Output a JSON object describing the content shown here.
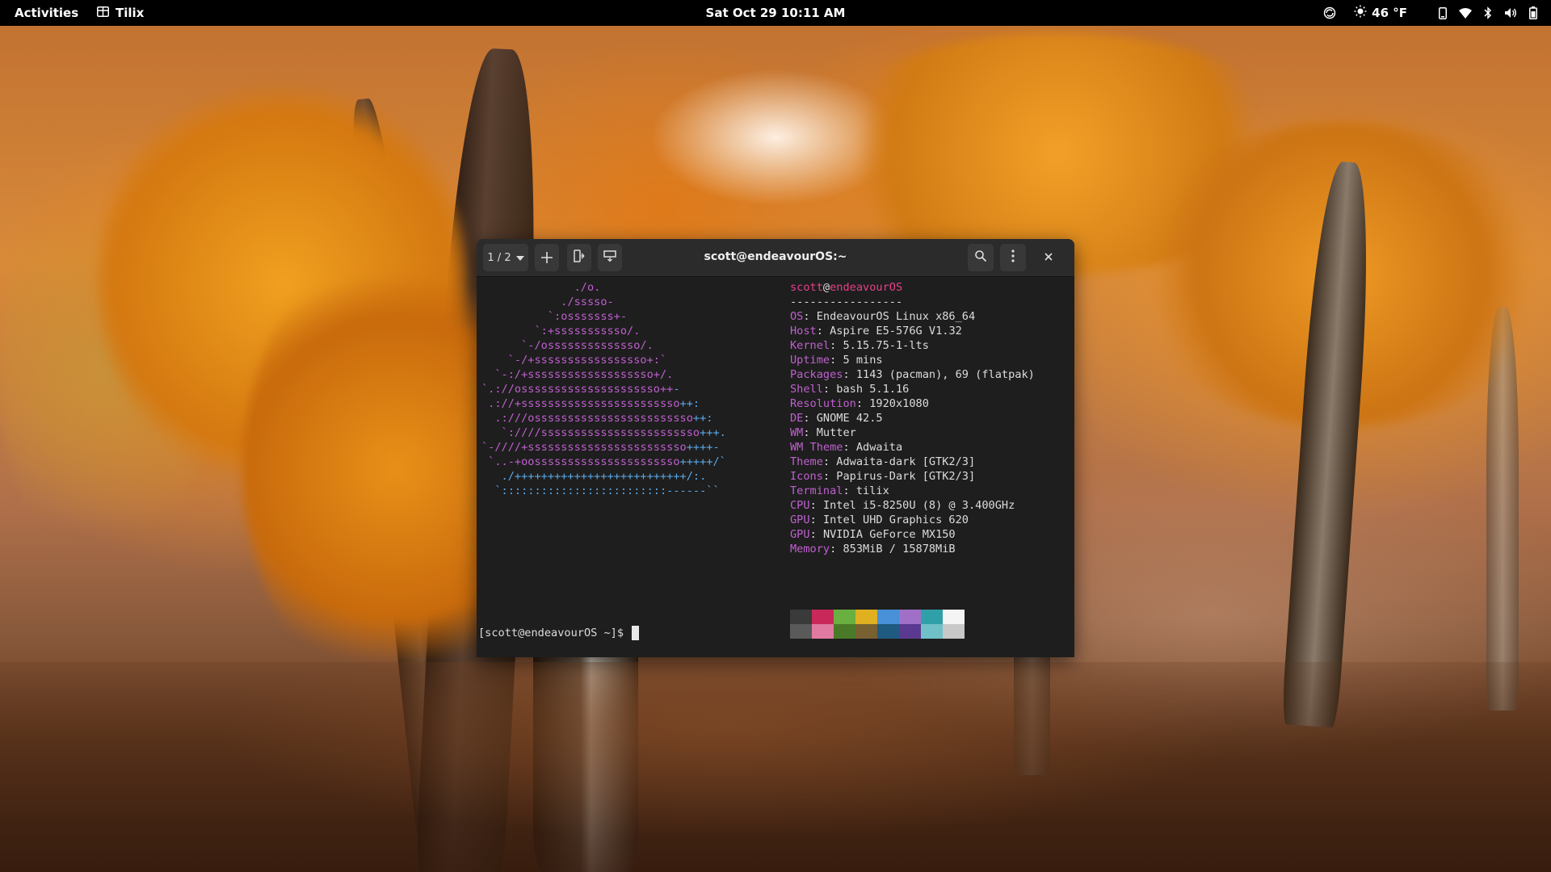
{
  "topbar": {
    "activities": "Activities",
    "app_name": "Tilix",
    "clock": "Sat Oct 29  10:11 AM",
    "weather": "46 °F",
    "tray_icons": [
      "screen-share-icon",
      "weather-sun-icon",
      "phone-icon",
      "wifi-icon",
      "bluetooth-icon",
      "volume-icon",
      "battery-icon"
    ]
  },
  "window": {
    "title": "scott@endeavourOS:~",
    "session_label": "1 / 2",
    "buttons": [
      "session-switcher",
      "add-terminal",
      "split-horizontal",
      "split-vertical",
      "search",
      "menu",
      "close"
    ]
  },
  "neofetch": {
    "logo_lines": [
      [
        [
          "p",
          "              ./o."
        ]
      ],
      [
        [
          "p",
          "            ./sssso-"
        ]
      ],
      [
        [
          "p",
          "          `:osssssss+-"
        ]
      ],
      [
        [
          "p",
          "        `:+sssssssssso/."
        ]
      ],
      [
        [
          "p",
          "      `-/ossssssssssssso/."
        ]
      ],
      [
        [
          "p",
          "    `-/+sssssssssssssssso+:`"
        ]
      ],
      [
        [
          "p",
          "  `-:/+sssssssssssssssssso+/."
        ]
      ],
      [
        [
          "p",
          "`.://osssssssssssssssssssso++"
        ],
        [
          "b",
          "-"
        ]
      ],
      [
        [
          "p",
          " .://+ssssssssssssssssssssssso"
        ],
        [
          "b",
          "++:"
        ]
      ],
      [
        [
          "p",
          "  .:///ossssssssssssssssssssssso"
        ],
        [
          "b",
          "++:"
        ]
      ],
      [
        [
          "p",
          "   `:////ssssssssssssssssssssssso"
        ],
        [
          "b",
          "+++."
        ]
      ],
      [
        [
          "p",
          "`-////+ssssssssssssssssssssssso"
        ],
        [
          "b",
          "++++-"
        ]
      ],
      [
        [
          "p",
          " `..-+oossssssssssssssssssssso"
        ],
        [
          "b",
          "+++++/`"
        ]
      ],
      [
        [
          "b",
          "   ./++++++++++++++++++++++++++/:."
        ]
      ],
      [
        [
          "b",
          "  `:::::::::::::::::::::::::------``"
        ]
      ]
    ],
    "user": "scott",
    "at": "@",
    "host": "endeavourOS",
    "separator": "-----------------",
    "fields": [
      {
        "key": "OS",
        "value": "EndeavourOS Linux x86_64"
      },
      {
        "key": "Host",
        "value": "Aspire E5-576G V1.32"
      },
      {
        "key": "Kernel",
        "value": "5.15.75-1-lts"
      },
      {
        "key": "Uptime",
        "value": "5 mins"
      },
      {
        "key": "Packages",
        "value": "1143 (pacman), 69 (flatpak)"
      },
      {
        "key": "Shell",
        "value": "bash 5.1.16"
      },
      {
        "key": "Resolution",
        "value": "1920x1080"
      },
      {
        "key": "DE",
        "value": "GNOME 42.5"
      },
      {
        "key": "WM",
        "value": "Mutter"
      },
      {
        "key": "WM Theme",
        "value": "Adwaita"
      },
      {
        "key": "Theme",
        "value": "Adwaita-dark [GTK2/3]"
      },
      {
        "key": "Icons",
        "value": "Papirus-Dark [GTK2/3]"
      },
      {
        "key": "Terminal",
        "value": "tilix"
      },
      {
        "key": "CPU",
        "value": "Intel i5-8250U (8) @ 3.400GHz"
      },
      {
        "key": "GPU",
        "value": "Intel UHD Graphics 620"
      },
      {
        "key": "GPU",
        "value": "NVIDIA GeForce MX150"
      },
      {
        "key": "Memory",
        "value": "853MiB / 15878MiB"
      }
    ],
    "palette_top": [
      "#3a3a3a",
      "#c8285a",
      "#6ab040",
      "#e0b020",
      "#4890d8",
      "#a070c8",
      "#30a0a8",
      "#f4f4f4"
    ],
    "palette_bottom": [
      "#5a5a5a",
      "#e07aa0",
      "#4a7a28",
      "#786030",
      "#1f5a80",
      "#5a3a90",
      "#70c0c8",
      "#c8c8c8"
    ]
  },
  "prompt": "[scott@endeavourOS ~]$ "
}
